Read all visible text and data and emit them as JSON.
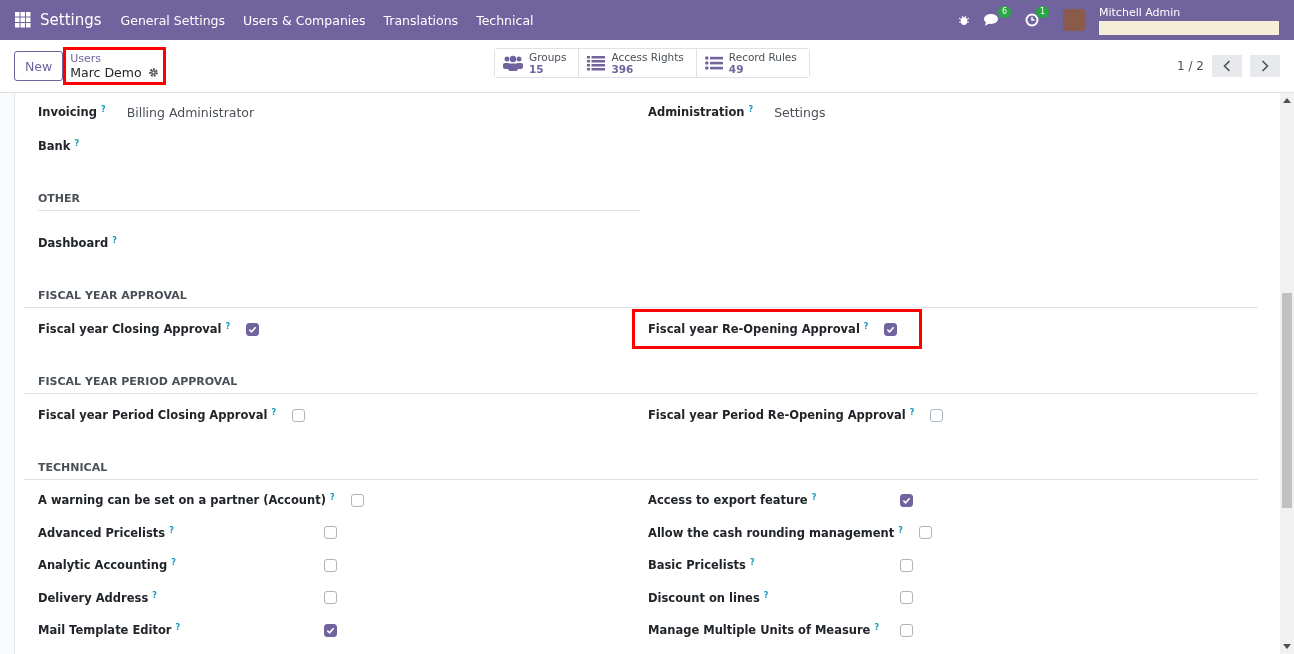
{
  "navbar": {
    "app_title": "Settings",
    "menu": [
      "General Settings",
      "Users & Companies",
      "Translations",
      "Technical"
    ],
    "messages_badge": "6",
    "activities_badge": "1",
    "user_name": "Mitchell Admin"
  },
  "control_panel": {
    "new_button": "New",
    "breadcrumb": {
      "parent": "Users",
      "record": "Marc Demo",
      "highlighted": true
    },
    "smart_buttons": [
      {
        "kind": "groups",
        "label": "Groups",
        "count": "15"
      },
      {
        "kind": "list",
        "label": "Access Rights",
        "count": "396"
      },
      {
        "kind": "rules",
        "label": "Record Rules",
        "count": "49"
      }
    ],
    "pager": "1 / 2"
  },
  "sections": [
    {
      "rows": [
        [
          {
            "label": "Invoicing",
            "help": "?",
            "kind": "text",
            "value": "Billing Administrator"
          },
          {
            "label": "Administration",
            "help": "?",
            "kind": "text",
            "value": "Settings"
          }
        ],
        [
          {
            "label": "Bank",
            "help": "?",
            "kind": "text"
          },
          null
        ]
      ]
    },
    {
      "title": "OTHER",
      "rows": [
        [
          {
            "label": "Dashboard",
            "help": "?",
            "kind": "text"
          },
          null
        ]
      ]
    },
    {
      "title": "FISCAL YEAR APPROVAL",
      "rows": [
        [
          {
            "label": "Fiscal year Closing Approval",
            "help": "?",
            "kind": "checkbox",
            "checked": true,
            "highlighted": false
          },
          {
            "label": "Fiscal year Re-Opening Approval",
            "help": "?",
            "kind": "checkbox",
            "checked": true,
            "highlighted": true
          }
        ]
      ]
    },
    {
      "title": "FISCAL YEAR PERIOD APPROVAL",
      "rows": [
        [
          {
            "label": "Fiscal year Period Closing Approval",
            "help": "?",
            "kind": "checkbox",
            "checked": false,
            "highlighted": false
          },
          {
            "label": "Fiscal year Period Re-Opening Approval",
            "help": "?",
            "kind": "checkbox",
            "checked": false,
            "highlighted": false
          }
        ]
      ]
    },
    {
      "title": "TECHNICAL",
      "rows": [
        [
          {
            "label": "A warning can be set on a partner (Account)",
            "help": "?",
            "kind": "checkbox",
            "checked": false,
            "highlighted": false
          },
          {
            "label": "Access to export feature",
            "help": "?",
            "kind": "checkbox",
            "checked": true,
            "highlighted": false
          }
        ],
        [
          {
            "label": "Advanced Pricelists",
            "help": "?",
            "kind": "checkbox",
            "checked": false,
            "highlighted": false
          },
          {
            "label": "Allow the cash rounding management",
            "help": "?",
            "kind": "checkbox",
            "checked": false,
            "highlighted": false
          }
        ],
        [
          {
            "label": "Analytic Accounting",
            "help": "?",
            "kind": "checkbox",
            "checked": false,
            "highlighted": false
          },
          {
            "label": "Basic Pricelists",
            "help": "?",
            "kind": "checkbox",
            "checked": false,
            "highlighted": false
          }
        ],
        [
          {
            "label": "Delivery Address",
            "help": "?",
            "kind": "checkbox",
            "checked": false,
            "highlighted": false
          },
          {
            "label": "Discount on lines",
            "help": "?",
            "kind": "checkbox",
            "checked": false,
            "highlighted": false
          }
        ],
        [
          {
            "label": "Mail Template Editor",
            "help": "?",
            "kind": "checkbox",
            "checked": true,
            "highlighted": false
          },
          {
            "label": "Manage Multiple Units of Measure",
            "help": "?",
            "kind": "checkbox",
            "checked": false,
            "highlighted": false
          }
        ]
      ]
    }
  ]
}
